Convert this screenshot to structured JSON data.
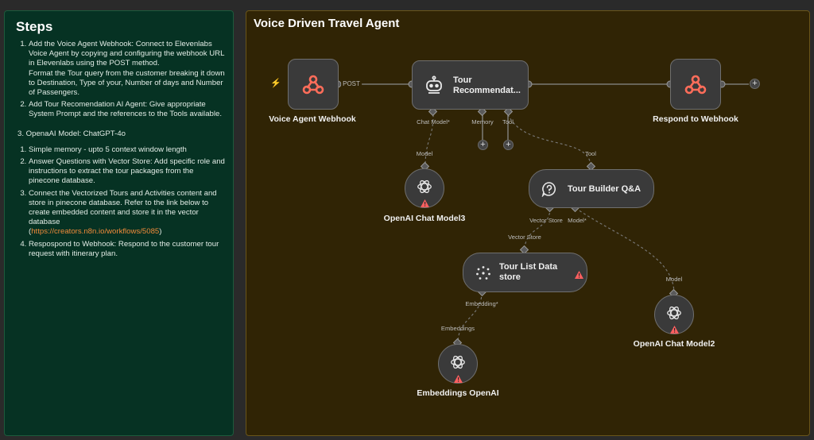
{
  "steps": {
    "title": "Steps",
    "items_a": [
      {
        "line1": "Add the Voice Agent Webhook: Connect to Elevenlabs Voice Agent by copying and configuring the webhook URL in Elevenlabs using the POST method.",
        "line2": "Format the Tour query from the customer breaking it down to Destination, Type of your, Number of days and Number of Passengers."
      },
      {
        "line1": "Add Tour Recomendation AI Agent: Give appropriate System Prompt and the references to the Tools available.",
        "line2": ""
      }
    ],
    "plain": "3. OpenaAI Model: ChatGPT-4o",
    "items_b": [
      "Simple memory - upto 5 context window length",
      "Answer Questions with Vector Store: Add specific role and instructions to extract the tour packages from the pinecone database.",
      "Connect the Vectorized Tours and Activities content and store in pinecone database. Refer to the link below to create embedded content and store it in the vector database",
      "Respospond to Webhook: Respond to the customer tour request with itinerary plan."
    ],
    "link_open": "(",
    "link": "https://creators.n8n.io/workflows/5085",
    "link_close": ")"
  },
  "canvas": {
    "title": "Voice Driven Travel Agent",
    "edge_post": "POST",
    "nodes": {
      "voice_webhook": {
        "label": "Voice Agent Webhook",
        "icon": "webhook-icon"
      },
      "tour_agent": {
        "label_line1": "Tour",
        "label_line2": "Recommendat...",
        "icon": "robot-icon"
      },
      "respond_webhook": {
        "label": "Respond to Webhook",
        "icon": "webhook-icon"
      },
      "chat_model3": {
        "label": "OpenAI Chat Model3",
        "icon": "openai-icon"
      },
      "tour_builder": {
        "label": "Tour Builder Q&A",
        "icon": "question-icon"
      },
      "tour_store": {
        "label_line1": "Tour List Data",
        "label_line2": "store",
        "icon": "pinecone-icon"
      },
      "chat_model2": {
        "label": "OpenAI Chat Model2",
        "icon": "openai-icon"
      },
      "embeddings": {
        "label": "Embeddings OpenAI",
        "icon": "openai-icon"
      }
    },
    "ports": {
      "chat_model": "Chat Model*",
      "memory": "Memory",
      "tool": "Tool",
      "model_a": "Model",
      "tool_in": "Tool",
      "vector_store": "Vector Store",
      "model": "Model*",
      "vector_store_in": "Vector Store",
      "model_b": "Model",
      "embedding": "Embedding*",
      "embeddings_in": "Embeddings"
    },
    "colors": {
      "webhook": "#ff6d5a",
      "warning": "#ff5f5f",
      "node_bg": "#3a3a3a",
      "wire": "#8a8a8a"
    }
  }
}
